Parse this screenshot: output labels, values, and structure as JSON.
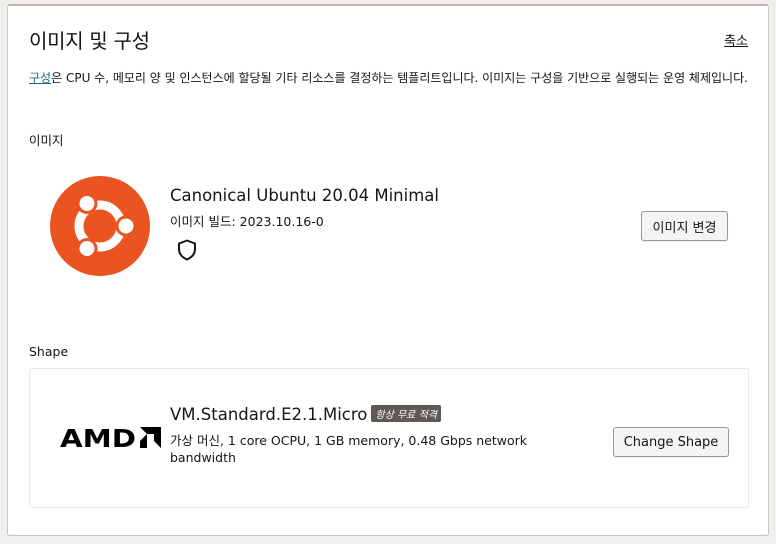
{
  "header": {
    "title": "이미지 및 구성",
    "collapse_label": "축소"
  },
  "description": {
    "link_text": "구성",
    "text": "은 CPU 수, 메모리 양 및 인스턴스에 할당될 기타 리소스를 결정하는 템플리트입니다. 이미지는 구성을 기반으로 실행되는 운영 체제입니다."
  },
  "image_section": {
    "label": "이미지",
    "name": "Canonical Ubuntu 20.04 Minimal",
    "build": "이미지 빌드: 2023.10.16-0",
    "logo_icon": "ubuntu-logo",
    "security_icon": "shield-icon",
    "change_button": "이미지 변경",
    "logo_color": "#e95420"
  },
  "shape_section": {
    "label": "Shape",
    "vendor_logo": "AMD",
    "name": "VM.Standard.E2.1.Micro",
    "badge": "항상 무료 적격",
    "description": "가상 머신, 1 core OCPU, 1 GB memory, 0.48 Gbps network bandwidth",
    "change_button": "Change Shape"
  }
}
